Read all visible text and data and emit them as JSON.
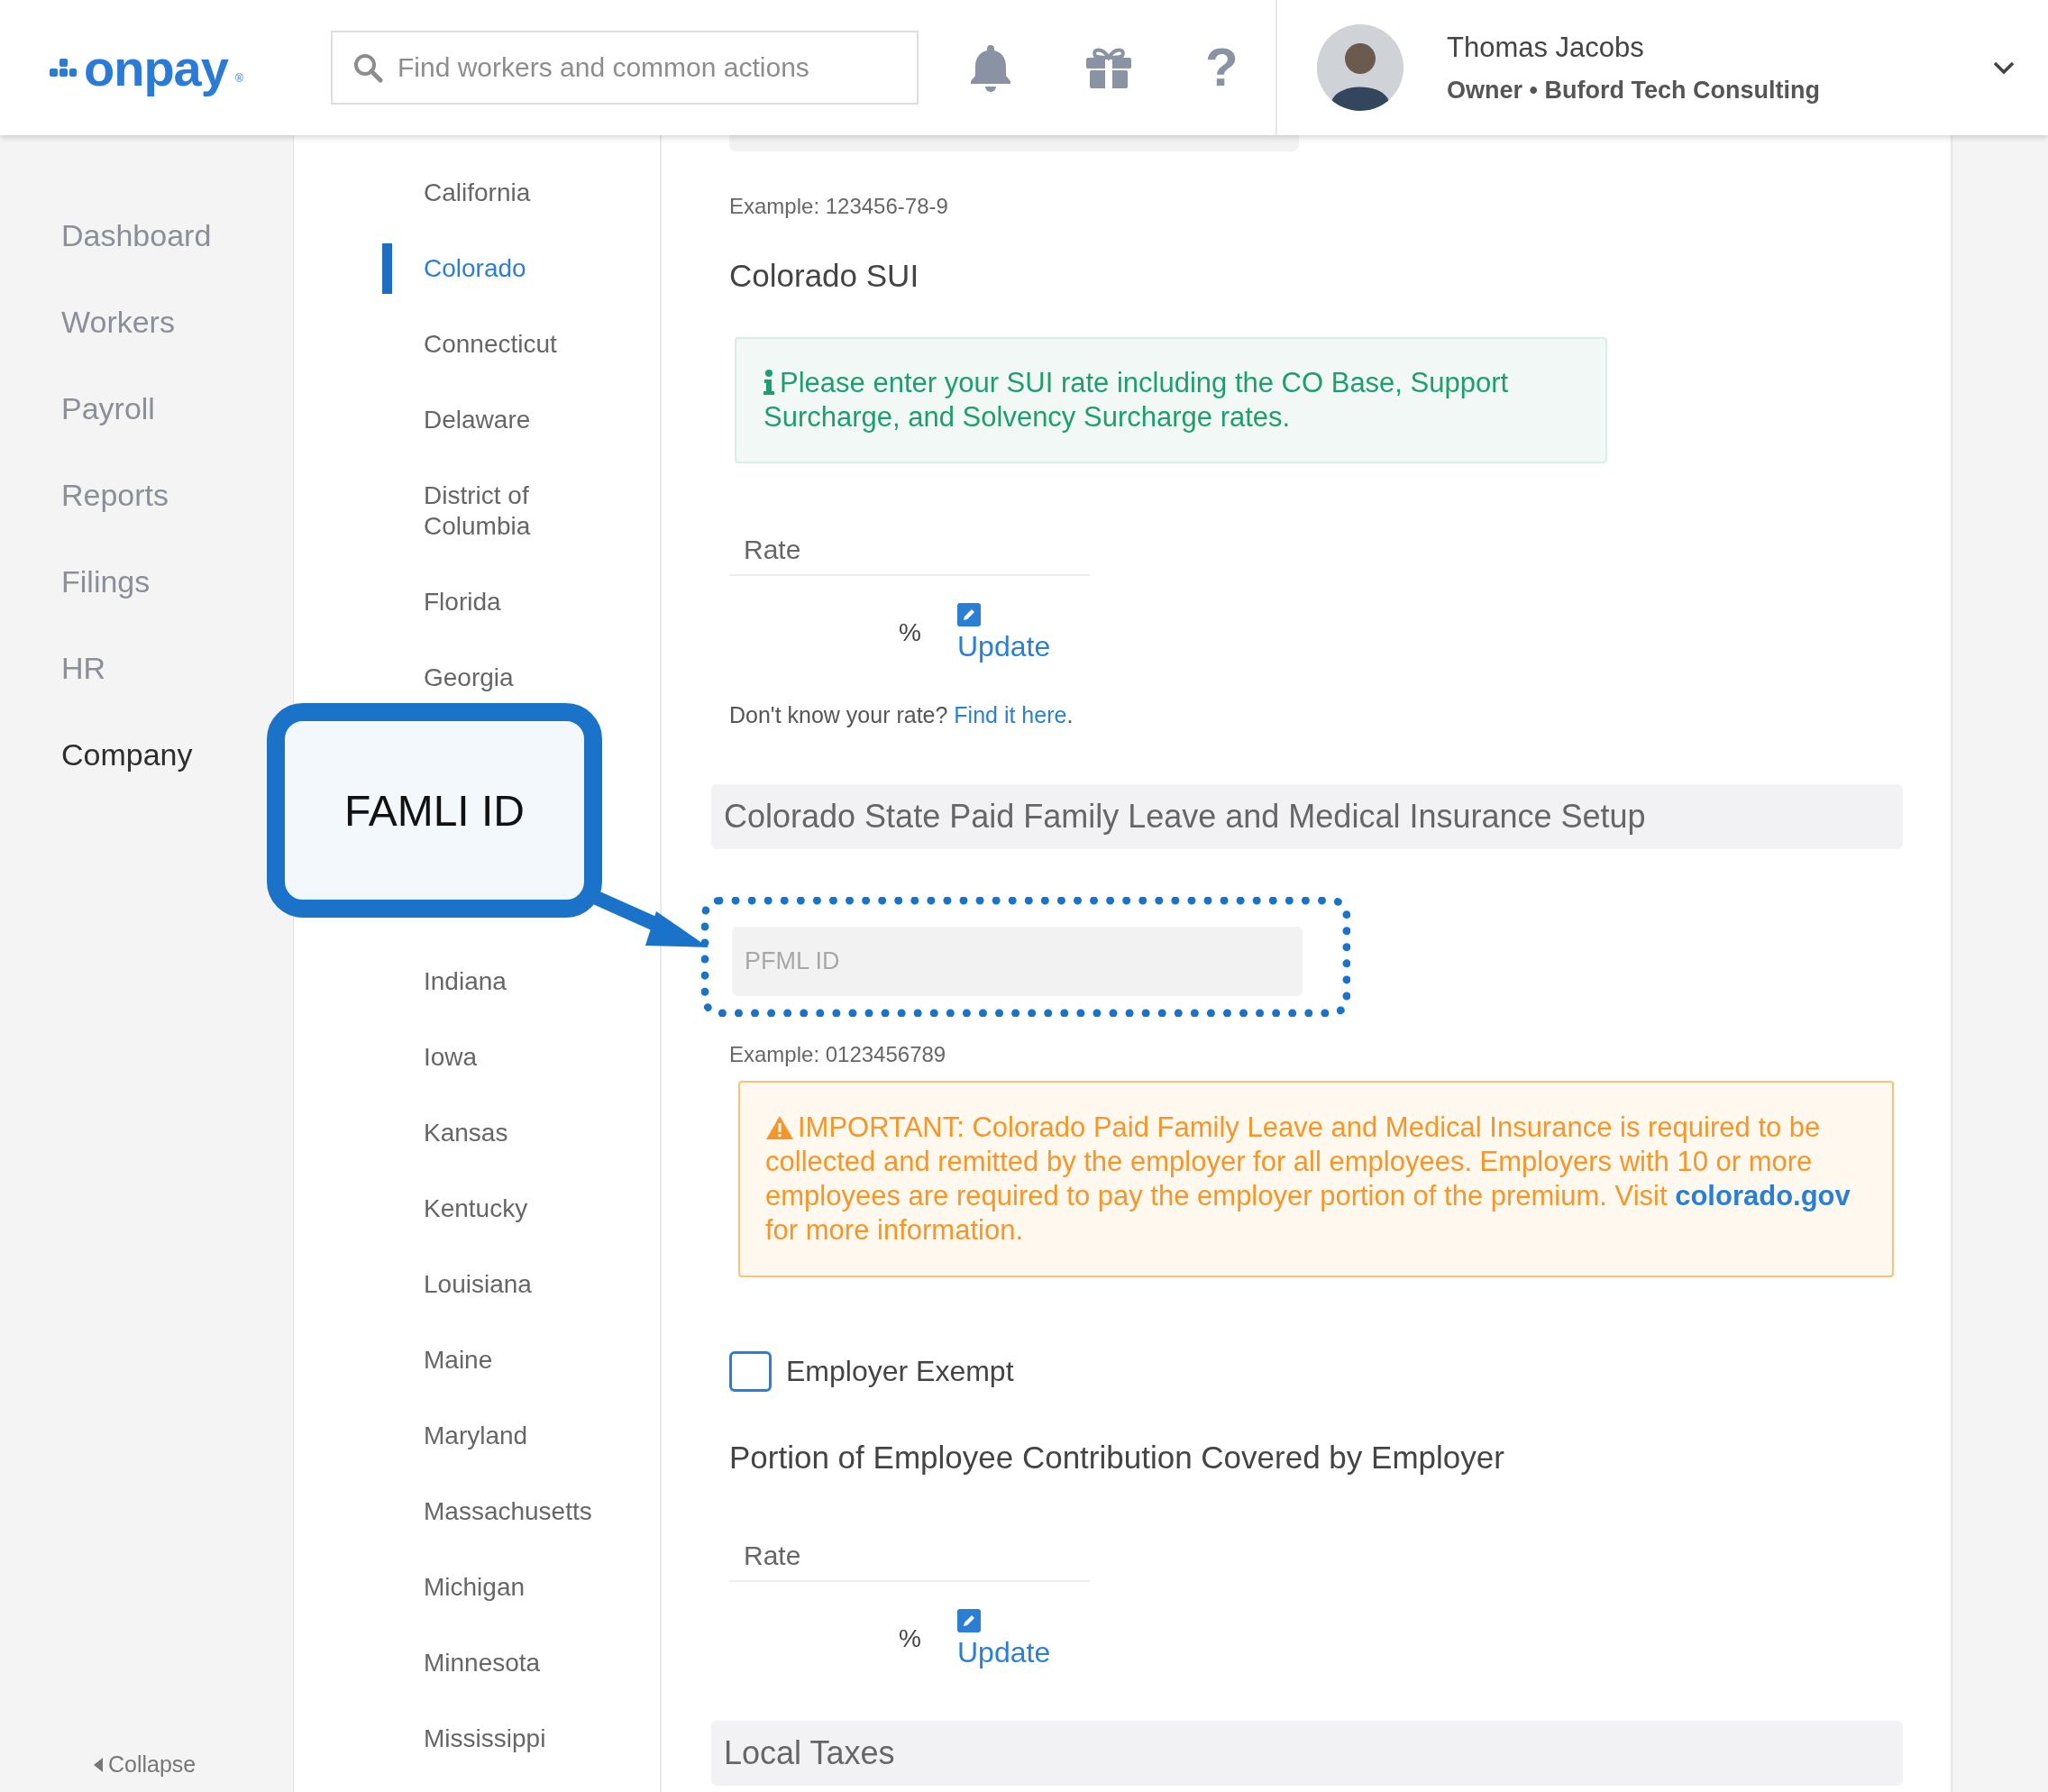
{
  "header": {
    "logo": {
      "text": "onpay",
      "mark": "®"
    },
    "search": {
      "placeholder": "Find workers and common actions"
    },
    "help_icon": "?",
    "user": {
      "name": "Thomas Jacobs",
      "role": "Owner • Buford Tech Consulting"
    }
  },
  "nav": {
    "items": [
      {
        "label": "Dashboard",
        "selected": false
      },
      {
        "label": "Workers",
        "selected": false
      },
      {
        "label": "Payroll",
        "selected": false
      },
      {
        "label": "Reports",
        "selected": false
      },
      {
        "label": "Filings",
        "selected": false
      },
      {
        "label": "HR",
        "selected": false
      },
      {
        "label": "Company",
        "selected": true
      }
    ],
    "collapse": "Collapse"
  },
  "state_nav": {
    "above_callout": [
      {
        "label": "California",
        "selected": false
      },
      {
        "label": "Colorado",
        "selected": true
      },
      {
        "label": "Connecticut",
        "selected": false
      },
      {
        "label": "Delaware",
        "selected": false
      },
      {
        "label": "District of Columbia",
        "selected": false
      },
      {
        "label": "Florida",
        "selected": false
      },
      {
        "label": "Georgia",
        "selected": false
      }
    ],
    "below_callout": [
      {
        "label": "Indiana",
        "selected": false
      },
      {
        "label": "Iowa",
        "selected": false
      },
      {
        "label": "Kansas",
        "selected": false
      },
      {
        "label": "Kentucky",
        "selected": false
      },
      {
        "label": "Louisiana",
        "selected": false
      },
      {
        "label": "Maine",
        "selected": false
      },
      {
        "label": "Maryland",
        "selected": false
      },
      {
        "label": "Massachusetts",
        "selected": false
      },
      {
        "label": "Michigan",
        "selected": false
      },
      {
        "label": "Minnesota",
        "selected": false
      },
      {
        "label": "Mississippi",
        "selected": false
      }
    ]
  },
  "content": {
    "fein_example": "Example: 123456-78-9",
    "sui": {
      "title": "Colorado SUI",
      "info": "Please enter your SUI rate including the CO Base, Support Surcharge, and Solvency Surcharge rates.",
      "rate_label": "Rate",
      "unit": "%",
      "update": "Update",
      "help": {
        "before": "Don't know your rate? ",
        "link": "Find it here",
        "after": "."
      }
    },
    "famli": {
      "section_title": "Colorado State Paid Family Leave and Medical Insurance Setup",
      "field": {
        "placeholder": "PFML ID"
      },
      "example": "Example: 0123456789",
      "warning": {
        "before": "IMPORTANT: Colorado Paid Family Leave and Medical Insurance is required to be collected and remitted by the employer for all employees. Employers with 10 or more employees are required to pay the employer portion of the premium. Visit ",
        "link": "colorado.gov",
        "after": " for more information."
      },
      "exempt": {
        "label": "Employer Exempt",
        "checked": false
      },
      "portion_title": "Portion of Employee Contribution Covered by Employer",
      "rate_label": "Rate",
      "unit": "%",
      "update": "Update"
    },
    "local_title": "Local Taxes"
  },
  "annotation": {
    "callout": "FAMLI ID"
  }
}
